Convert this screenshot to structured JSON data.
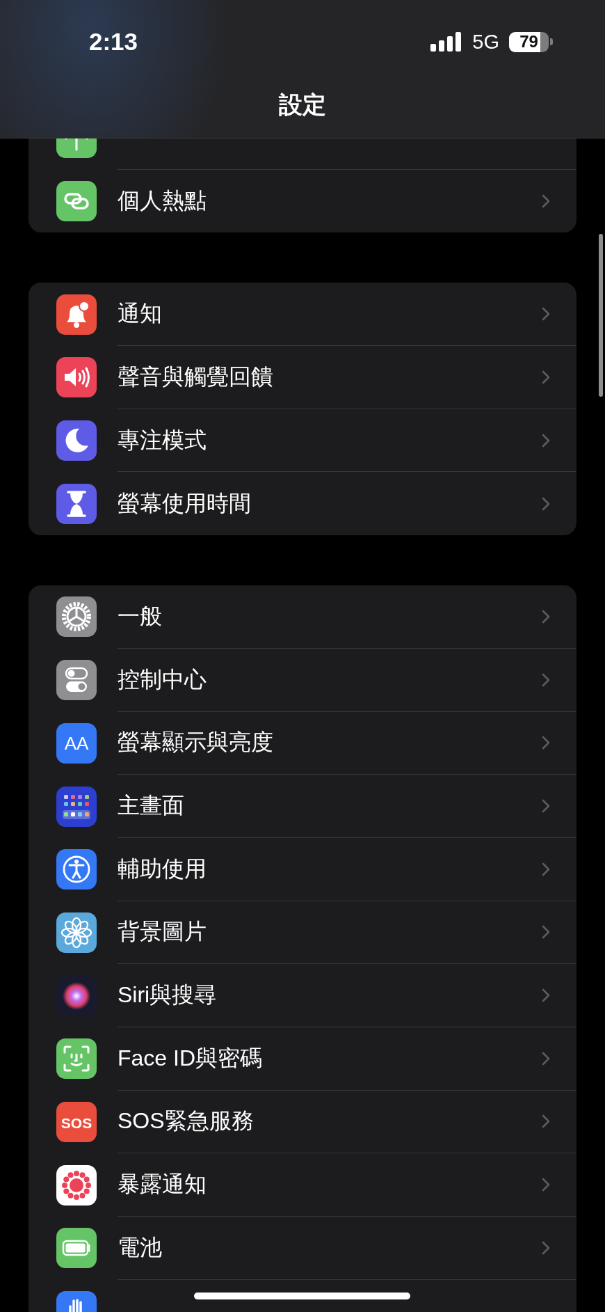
{
  "status_bar": {
    "time": "2:13",
    "network": "5G",
    "battery": {
      "reading": "79",
      "level": 0.79
    }
  },
  "title": "設定",
  "groups": [
    {
      "items": [
        {
          "kind": "cellular"
        },
        {
          "kind": "hotspot",
          "label": "個人熱點"
        }
      ]
    },
    {
      "items": [
        {
          "kind": "notifications",
          "label": "通知"
        },
        {
          "kind": "sounds",
          "label": "聲音與觸覺回饋"
        },
        {
          "kind": "focus",
          "label": "專注模式"
        },
        {
          "kind": "screentime",
          "label": "螢幕使用時間"
        }
      ]
    },
    {
      "items": [
        {
          "kind": "general",
          "label": "一般"
        },
        {
          "kind": "control",
          "label": "控制中心"
        },
        {
          "kind": "display",
          "label": "螢幕顯示與亮度",
          "icon_text": "AA"
        },
        {
          "kind": "homescreen",
          "label": "主畫面"
        },
        {
          "kind": "accessibility",
          "label": "輔助使用"
        },
        {
          "kind": "wallpaper",
          "label": "背景圖片"
        },
        {
          "kind": "siri",
          "label": "Siri與搜尋"
        },
        {
          "kind": "faceid",
          "label": "Face ID與密碼"
        },
        {
          "kind": "sos",
          "label": "SOS緊急服務",
          "icon_text": "SOS"
        },
        {
          "kind": "exposure",
          "label": "暴露通知"
        },
        {
          "kind": "battery",
          "label": "電池"
        },
        {
          "kind": "privacy"
        }
      ]
    }
  ]
}
